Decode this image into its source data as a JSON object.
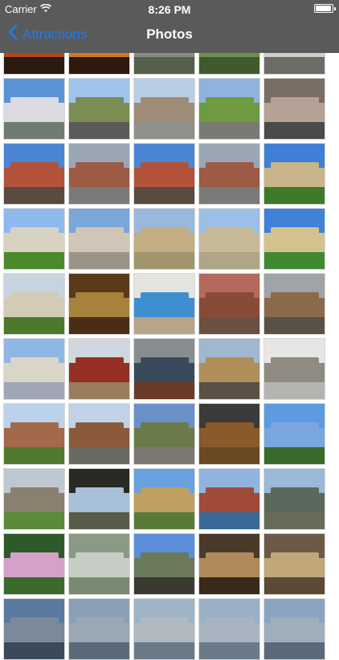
{
  "status": {
    "carrier": "Carrier",
    "time": "8:26 PM"
  },
  "nav": {
    "back_label": "Attractions",
    "title": "Photos"
  },
  "photos": [
    {
      "sky": "#1a0e08",
      "mid": "#b5461a",
      "ground": "#2a1a10"
    },
    {
      "sky": "#1a0c06",
      "mid": "#d07a28",
      "ground": "#30180c"
    },
    {
      "sky": "#6a7a64",
      "mid": "#8b8b86",
      "ground": "#55604a"
    },
    {
      "sky": "#7a8a6a",
      "mid": "#6f8f4a",
      "ground": "#405a30"
    },
    {
      "sky": "#a7a8a5",
      "mid": "#cfcfc8",
      "ground": "#6d6d68"
    },
    {
      "sky": "#5c93d6",
      "mid": "#d9dbe0",
      "ground": "#6f7a70"
    },
    {
      "sky": "#9fc3ea",
      "mid": "#7a8e54",
      "ground": "#5a5a58"
    },
    {
      "sky": "#b9cde3",
      "mid": "#9f8c78",
      "ground": "#8f8f8b"
    },
    {
      "sky": "#8fb3de",
      "mid": "#6e9a40",
      "ground": "#7a7a74"
    },
    {
      "sky": "#7a6d66",
      "mid": "#b5a295",
      "ground": "#4a4a4a"
    },
    {
      "sky": "#4d85d5",
      "mid": "#b3523a",
      "ground": "#5a4a40"
    },
    {
      "sky": "#9aa6b4",
      "mid": "#9d5a46",
      "ground": "#7a7a78"
    },
    {
      "sky": "#4d85d5",
      "mid": "#b3523a",
      "ground": "#5a4a40"
    },
    {
      "sky": "#9aa6b4",
      "mid": "#9d5a46",
      "ground": "#7a7a78"
    },
    {
      "sky": "#3f7fd5",
      "mid": "#c9b58a",
      "ground": "#3d7a2a"
    },
    {
      "sky": "#8db9ee",
      "mid": "#d8d2c0",
      "ground": "#4a8a2a"
    },
    {
      "sky": "#7aa6dc",
      "mid": "#cfc6b5",
      "ground": "#9a9488"
    },
    {
      "sky": "#9ab8de",
      "mid": "#c2ae82",
      "ground": "#a0956e"
    },
    {
      "sky": "#9bbfe5",
      "mid": "#c8b998",
      "ground": "#b0a588"
    },
    {
      "sky": "#3f82da",
      "mid": "#d4c28e",
      "ground": "#3f8a30"
    },
    {
      "sky": "#c7d3df",
      "mid": "#d2ccb7",
      "ground": "#4a7a2a"
    },
    {
      "sky": "#5a3a1a",
      "mid": "#a8823a",
      "ground": "#4a2e14"
    },
    {
      "sky": "#e4e4e0",
      "mid": "#3e8fd0",
      "ground": "#b7a58a"
    },
    {
      "sky": "#b46a5a",
      "mid": "#8a4a3a",
      "ground": "#6a5040"
    },
    {
      "sky": "#9fa4a8",
      "mid": "#8a6a4a",
      "ground": "#5a5046"
    },
    {
      "sky": "#8fb7e4",
      "mid": "#d9d5c8",
      "ground": "#9fa7b5"
    },
    {
      "sky": "#cfd6dd",
      "mid": "#963025",
      "ground": "#9b7c5a"
    },
    {
      "sky": "#8a8d90",
      "mid": "#3a4a5a",
      "ground": "#6a3a2a"
    },
    {
      "sky": "#9fb8d0",
      "mid": "#b08e5a",
      "ground": "#5a5046"
    },
    {
      "sky": "#e6e6e4",
      "mid": "#8f8a82",
      "ground": "#b4b4b0"
    },
    {
      "sky": "#bcd1ea",
      "mid": "#a2694a",
      "ground": "#4f7a30"
    },
    {
      "sky": "#c2d2e6",
      "mid": "#8a5a3a",
      "ground": "#6a6a62"
    },
    {
      "sky": "#6a90c8",
      "mid": "#6a7a4a",
      "ground": "#7a7870"
    },
    {
      "sky": "#3a3a3a",
      "mid": "#8a5a2a",
      "ground": "#6a4a20"
    },
    {
      "sky": "#5d9ae0",
      "mid": "#7aa6e0",
      "ground": "#3a6a2a"
    },
    {
      "sky": "#bfc8d0",
      "mid": "#8a8070",
      "ground": "#5a8a3a"
    },
    {
      "sky": "#2a2a24",
      "mid": "#a8c0d8",
      "ground": "#5a5a48"
    },
    {
      "sky": "#6aa0e0",
      "mid": "#bfa060",
      "ground": "#5a7a3a"
    },
    {
      "sky": "#8fb4e0",
      "mid": "#a04a3a",
      "ground": "#3a6a9a"
    },
    {
      "sky": "#9ab8d8",
      "mid": "#5a6a5a",
      "ground": "#6a6a5a"
    },
    {
      "sky": "#2e5a2a",
      "mid": "#d7a0c8",
      "ground": "#3a6a2a"
    },
    {
      "sky": "#8a9a86",
      "mid": "#c6cdc4",
      "ground": "#7a8a72"
    },
    {
      "sky": "#5a8ed8",
      "mid": "#6a7a5a",
      "ground": "#3a3a30"
    },
    {
      "sky": "#4a3a2a",
      "mid": "#b08a5a",
      "ground": "#3a2a1a"
    },
    {
      "sky": "#6a5a46",
      "mid": "#c0a878",
      "ground": "#5a4a36"
    },
    {
      "sky": "#5a7aa0",
      "mid": "#7a8a9a",
      "ground": "#3a4a5a"
    },
    {
      "sky": "#8aa0b8",
      "mid": "#9aa8b4",
      "ground": "#5a6a7a"
    },
    {
      "sky": "#a0b4c8",
      "mid": "#b0b8c0",
      "ground": "#6a7888"
    },
    {
      "sky": "#9ab0c4",
      "mid": "#a8b4c0",
      "ground": "#6a7a8a"
    },
    {
      "sky": "#8aa4c0",
      "mid": "#a0aebc",
      "ground": "#5a6a7c"
    }
  ]
}
